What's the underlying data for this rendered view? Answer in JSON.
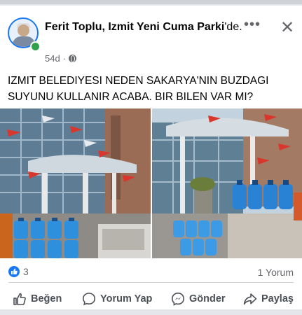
{
  "post": {
    "author": "Ferit Toplu",
    "location": "Izmit Yeni Cuma Parki",
    "location_suffix": "'de.",
    "time": "54d",
    "text": "IZMIT BELEDIYESI NEDEN SAKARYA'NIN BUZDAGI SUYUNU KULLANIR ACABA. BIR BILEN VAR MI?"
  },
  "header": {
    "more_icon": "more-dots-icon",
    "close_icon": "close-icon",
    "visibility_icon": "globe-icon"
  },
  "photos": [
    {
      "name": "photo-building-left",
      "description_icon": "building-photo"
    },
    {
      "name": "photo-truck-right",
      "description_icon": "building-photo"
    }
  ],
  "stats": {
    "reactions_count": "3",
    "comments_label": "1 Yorum"
  },
  "actions": {
    "like": "Beğen",
    "comment": "Yorum Yap",
    "send": "Gönder",
    "share": "Paylaş"
  },
  "colors": {
    "accent": "#1877f2",
    "online": "#31a24c",
    "muted": "#65676b"
  }
}
